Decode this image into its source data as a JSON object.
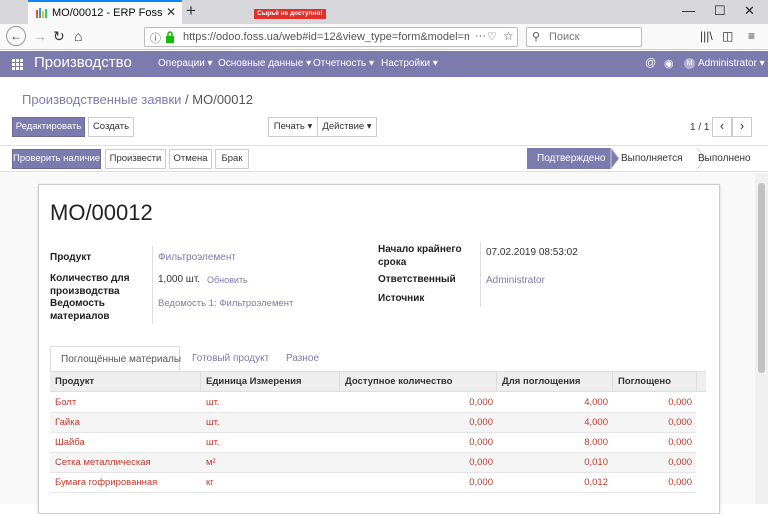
{
  "browser": {
    "tab_title": "MO/00012 - ERP Foss",
    "url": "https://odoo.foss.ua/web#id=12&view_type=form&model=m",
    "search_placeholder": "Поиск"
  },
  "app": {
    "brand": "Производство",
    "menus": [
      "Операции ▾",
      "Основные данные ▾",
      "Отчетность ▾",
      "Настройки ▾"
    ],
    "user": "Administrator ▾",
    "avatar_initials": "M",
    "accent_color": "#7c7bad"
  },
  "breadcrumb": {
    "parent": "Производственные заявки",
    "separator": "/",
    "current": "MO/00012"
  },
  "toolbar": {
    "edit": "Редактировать",
    "create": "Создать",
    "print": "Печать ▾",
    "action": "Действие ▾",
    "pager": "1 / 1",
    "prev": "‹",
    "next": "›"
  },
  "status_actions": {
    "check": "Проверить наличие",
    "produce": "Произвести",
    "cancel": "Отмена",
    "scrap": "Брак",
    "alert": "Сырьё не доступно!"
  },
  "stages": [
    "Подтверждено",
    "Выполняется",
    "Выполнено"
  ],
  "record": {
    "name": "MO/00012",
    "product_label": "Продукт",
    "product_value": "Фильтроэлемент",
    "qty_label": "Количество для производства",
    "qty_value": "1,000 шт.",
    "update": "Обновить",
    "bom_label": "Ведомость материалов",
    "bom_value": "Ведомость 1: Фильтроэлемент",
    "deadline_label": "Начало крайнего срока",
    "deadline_value": "07.02.2019 08:53:02",
    "responsible_label": "Ответственный",
    "responsible_value": "Administrator",
    "source_label": "Источник"
  },
  "tabs": [
    "Поглощённые материалы",
    "Готовый продукт",
    "Разное"
  ],
  "table": {
    "headers": [
      "Продукт",
      "Единица Измерения",
      "Доступное количество",
      "Для поглощения",
      "Поглощено"
    ],
    "rows": [
      [
        "Болт",
        "шт.",
        "0,000",
        "4,000",
        "0,000"
      ],
      [
        "Гайка",
        "шт.",
        "0,000",
        "4,000",
        "0,000"
      ],
      [
        "Шайба",
        "шт.",
        "0,000",
        "8,000",
        "0,000"
      ],
      [
        "Сетка металлическая",
        "м²",
        "0,000",
        "0,010",
        "0,000"
      ],
      [
        "Бумага гофрированная",
        "кг",
        "0,000",
        "0,012",
        "0,000"
      ]
    ]
  }
}
